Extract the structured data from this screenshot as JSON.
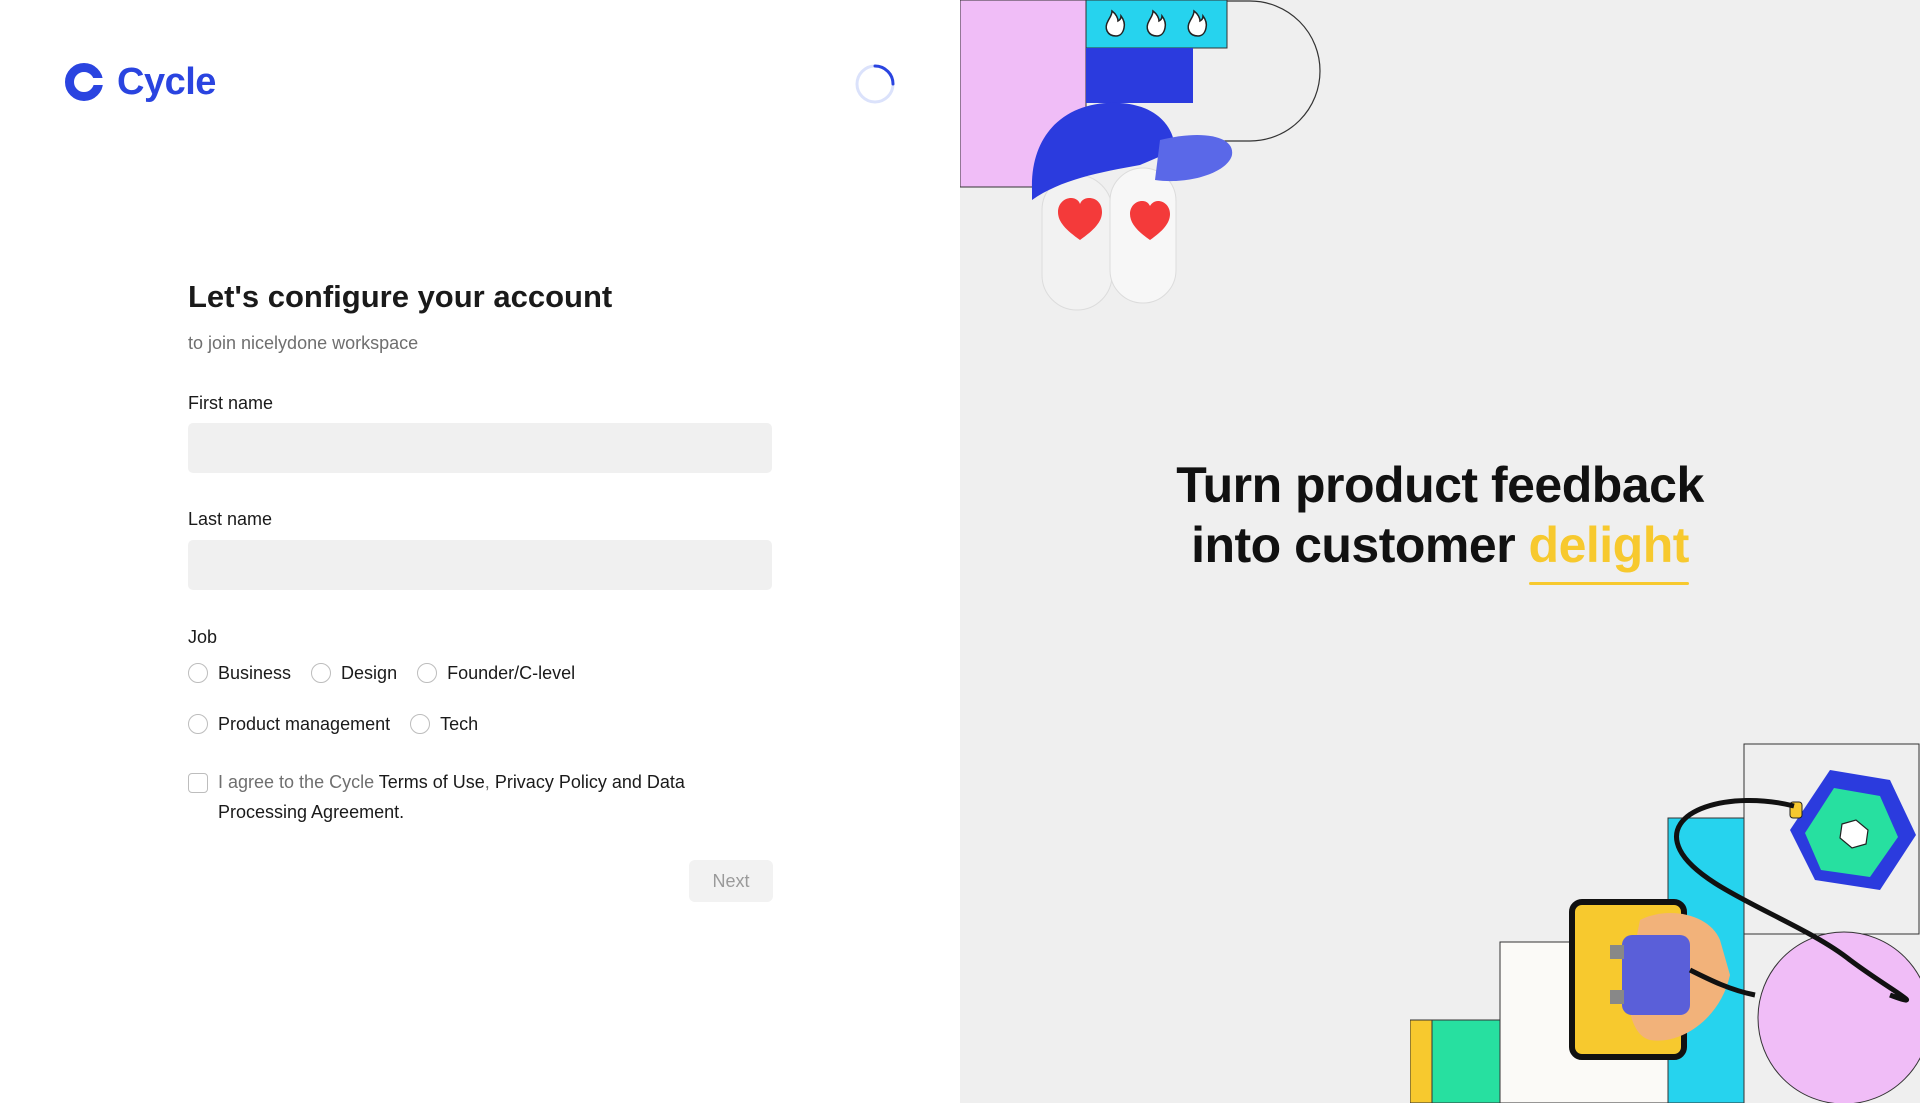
{
  "brand": {
    "name": "Cycle",
    "color": "#2a44e0"
  },
  "form": {
    "title": "Let's configure your account",
    "subtitle": "to join nicelydone workspace",
    "first_name": {
      "label": "First name",
      "value": "",
      "placeholder": ""
    },
    "last_name": {
      "label": "Last name",
      "value": "",
      "placeholder": ""
    },
    "job": {
      "label": "Job",
      "options": [
        "Business",
        "Design",
        "Founder/C-level",
        "Product management",
        "Tech"
      ]
    },
    "agreement": {
      "prefix": "I agree to the Cycle ",
      "terms": "Terms of Use",
      "comma": ", ",
      "privacy": "Privacy Policy and Data Processing Agreement."
    },
    "next_label": "Next"
  },
  "hero": {
    "line1": "Turn product feedback",
    "line2_prefix": "into customer ",
    "highlight": "delight",
    "highlight_color": "#f7c92e"
  },
  "icons": {
    "logo": "cycle-logo-icon",
    "loading": "loading-spinner-icon"
  }
}
